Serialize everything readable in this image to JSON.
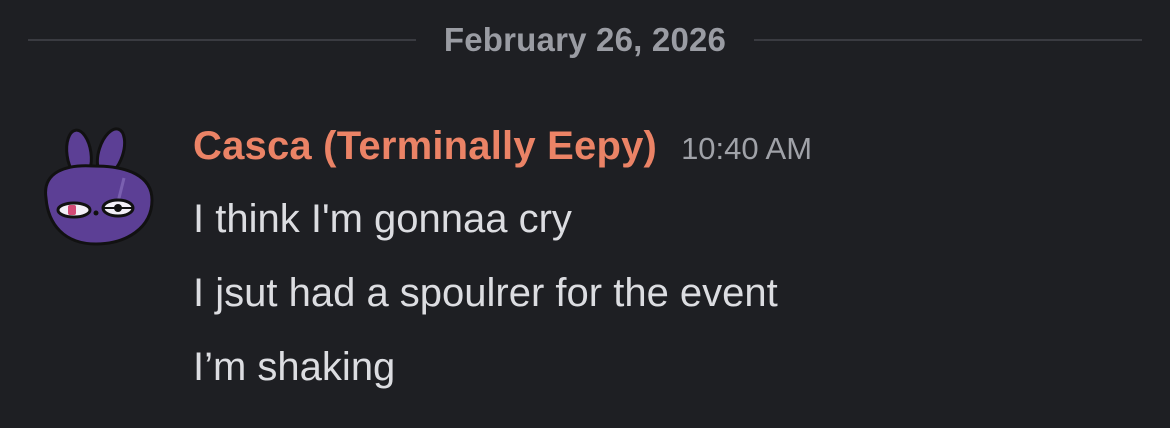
{
  "date_divider": {
    "label": "February 26, 2026"
  },
  "message": {
    "author": "Casca (Terminally Eepy)",
    "author_color": "#eb8366",
    "timestamp": "10:40 AM",
    "avatar_icon": "purple-bunny-avatar-icon",
    "lines": [
      "I think I'm gonnaa cry",
      "I jsut had a spoulrer for the event",
      "I’m shaking"
    ]
  },
  "colors": {
    "background": "#1e1f23",
    "divider": "#3a3b41",
    "text": "#dcdde1",
    "muted": "#a0a2a8",
    "avatar": "#5c3f95"
  }
}
